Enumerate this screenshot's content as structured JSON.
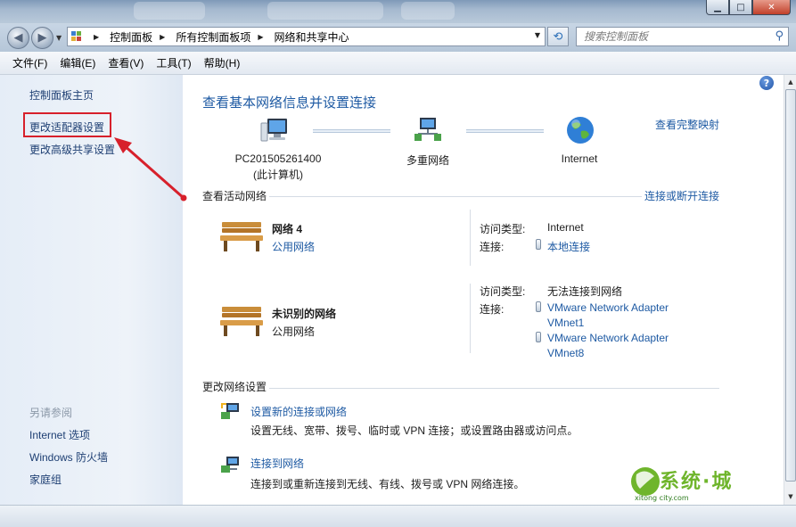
{
  "window": {
    "buttons": {
      "minimize": "▁",
      "maximize": "□",
      "close": "✕"
    }
  },
  "address_bar": {
    "crumbs": [
      "控制面板",
      "所有控制面板项",
      "网络和共享中心"
    ]
  },
  "search": {
    "placeholder": "搜索控制面板"
  },
  "menu": [
    "文件(F)",
    "编辑(E)",
    "查看(V)",
    "工具(T)",
    "帮助(H)"
  ],
  "sidebar": {
    "home": "控制面板主页",
    "items": [
      "更改适配器设置",
      "更改高级共享设置"
    ],
    "see_also_title": "另请参阅",
    "see_also": [
      "Internet 选项",
      "Windows 防火墙",
      "家庭组"
    ]
  },
  "main": {
    "title": "查看基本网络信息并设置连接",
    "full_map_link": "查看完整映射",
    "map_nodes": [
      {
        "line1": "PC201505261400",
        "line2": "(此计算机)"
      },
      {
        "line1": "多重网络",
        "line2": ""
      },
      {
        "line1": "Internet",
        "line2": ""
      }
    ],
    "active_networks": {
      "heading": "查看活动网络",
      "connect_link": "连接或断开连接",
      "networks": [
        {
          "name": "网络  4",
          "type": "公用网络",
          "type_is_link": true,
          "access_label": "访问类型:",
          "access_value": "Internet",
          "conn_label": "连接:",
          "connections": [
            "本地连接"
          ]
        },
        {
          "name": "未识别的网络",
          "type": "公用网络",
          "type_is_link": false,
          "access_label": "访问类型:",
          "access_value": "无法连接到网络",
          "conn_label": "连接:",
          "connections": [
            "VMware Network Adapter",
            "VMnet1",
            "VMware Network Adapter",
            "VMnet8"
          ]
        }
      ]
    },
    "change_settings": {
      "heading": "更改网络设置",
      "items": [
        {
          "link": "设置新的连接或网络",
          "desc": "设置无线、宽带、拨号、临时或 VPN 连接；或设置路由器或访问点。"
        },
        {
          "link": "连接到网络",
          "desc": "连接到或重新连接到无线、有线、拨号或 VPN 网络连接。"
        }
      ]
    }
  },
  "watermark": {
    "text": "系统·城",
    "sub": "xitong city.com"
  },
  "colors": {
    "link": "#1e5aa3",
    "highlight": "#d7202b",
    "watermark": "#6fb52c"
  }
}
